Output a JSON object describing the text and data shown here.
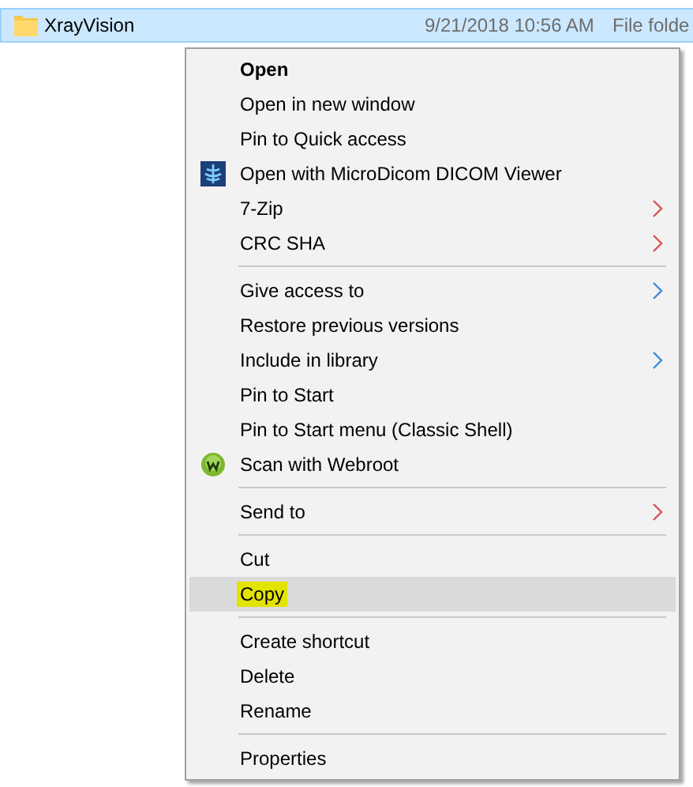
{
  "file_row": {
    "name": "XrayVision",
    "date": "9/21/2018 10:56 AM",
    "type": "File folde",
    "selected": true
  },
  "context_menu": {
    "sections": [
      [
        {
          "label": "Open",
          "bold": true,
          "submenu": false,
          "selected": false,
          "highlighted": false
        },
        {
          "label": "Open in new window",
          "bold": false,
          "submenu": false,
          "selected": false,
          "highlighted": false
        },
        {
          "label": "Pin to Quick access",
          "bold": false,
          "submenu": false,
          "selected": false,
          "highlighted": false
        },
        {
          "label": "Open with MicroDicom DICOM Viewer",
          "bold": false,
          "submenu": false,
          "selected": false,
          "highlighted": false,
          "kind": "xray"
        },
        {
          "label": "7-Zip",
          "bold": false,
          "submenu": true,
          "color": "#d9534f",
          "selected": false,
          "highlighted": false
        },
        {
          "label": "CRC SHA",
          "bold": false,
          "submenu": true,
          "color": "#d9534f",
          "selected": false,
          "highlighted": false
        }
      ],
      [
        {
          "label": "Give access to",
          "bold": false,
          "submenu": true,
          "color": "#3c8ad8",
          "selected": false,
          "highlighted": false
        },
        {
          "label": "Restore previous versions",
          "bold": false,
          "submenu": false,
          "selected": false,
          "highlighted": false
        },
        {
          "label": "Include in library",
          "bold": false,
          "submenu": true,
          "color": "#3c8ad8",
          "selected": false,
          "highlighted": false
        },
        {
          "label": "Pin to Start",
          "bold": false,
          "submenu": false,
          "selected": false,
          "highlighted": false
        },
        {
          "label": "Pin to Start menu (Classic Shell)",
          "bold": false,
          "submenu": false,
          "selected": false,
          "highlighted": false
        },
        {
          "label": "Scan with Webroot",
          "bold": false,
          "submenu": false,
          "selected": false,
          "highlighted": false,
          "kind": "webroot"
        }
      ],
      [
        {
          "label": "Send to",
          "bold": false,
          "submenu": true,
          "color": "#d9534f",
          "selected": false,
          "highlighted": false
        }
      ],
      [
        {
          "label": "Cut",
          "bold": false,
          "submenu": false,
          "selected": false,
          "highlighted": false
        },
        {
          "label": "Copy",
          "bold": false,
          "submenu": false,
          "selected": true,
          "highlighted": true
        }
      ],
      [
        {
          "label": "Create shortcut",
          "bold": false,
          "submenu": false,
          "selected": false,
          "highlighted": false
        },
        {
          "label": "Delete",
          "bold": false,
          "submenu": false,
          "selected": false,
          "highlighted": false
        },
        {
          "label": "Rename",
          "bold": false,
          "submenu": false,
          "selected": false,
          "highlighted": false
        }
      ],
      [
        {
          "label": "Properties",
          "bold": false,
          "submenu": false,
          "selected": false,
          "highlighted": false
        }
      ]
    ]
  }
}
